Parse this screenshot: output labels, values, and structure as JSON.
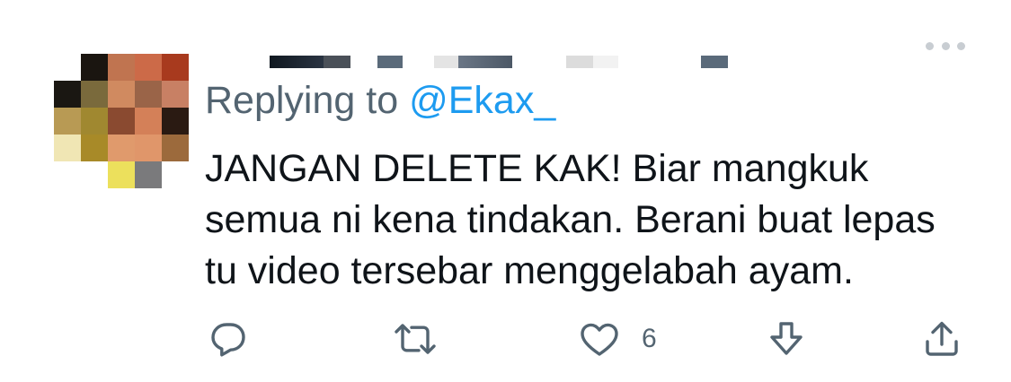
{
  "tweet": {
    "replying_prefix": "Replying to",
    "replying_handle": "@Ekax_",
    "body_lines": [
      "JANGAN DELETE KAK! Biar mangkuk",
      "semua ni kena tindakan. Berani buat lepas",
      "tu video tersebar menggelabah ayam."
    ],
    "actions": {
      "reply_icon": "reply-icon",
      "retweet_icon": "retweet-icon",
      "like_icon": "heart-icon",
      "like_count": "6",
      "download_icon": "download-icon",
      "share_icon": "share-icon"
    },
    "colors": {
      "text": "#0f1419",
      "secondary": "#536471",
      "link": "#1d9bf0",
      "icon": "#536471"
    }
  }
}
